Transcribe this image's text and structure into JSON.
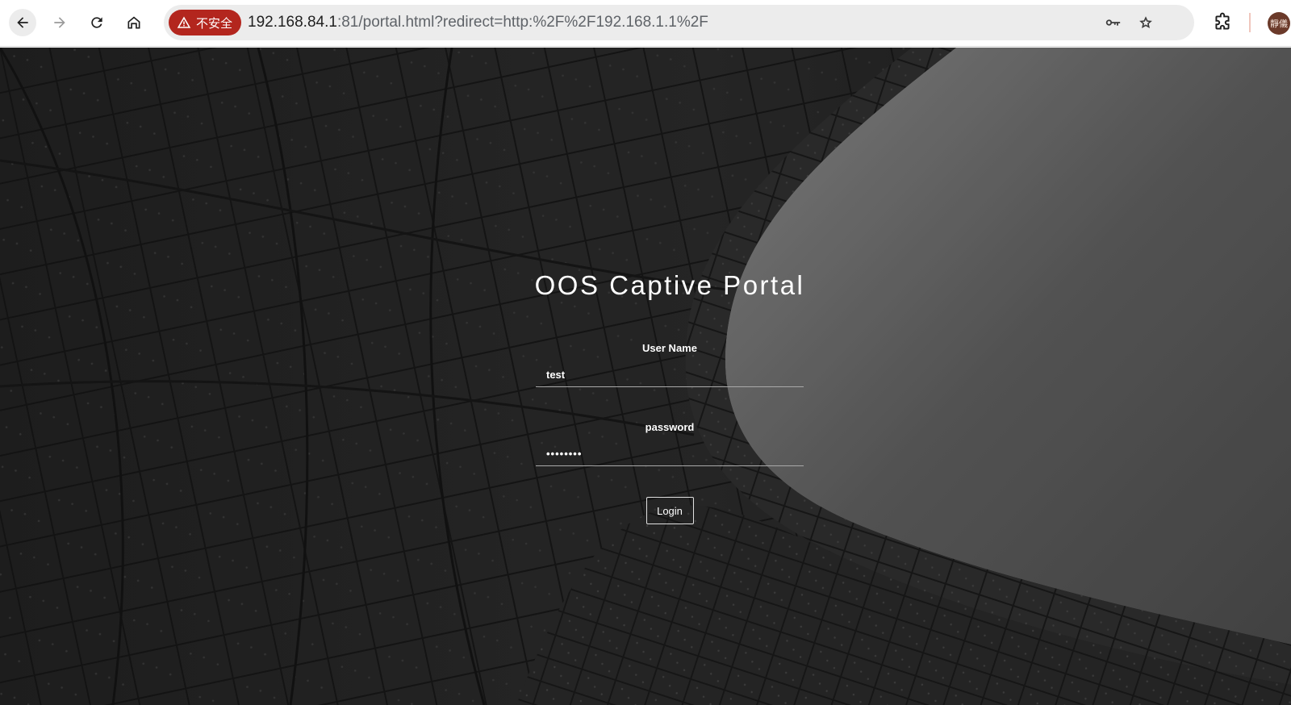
{
  "browser": {
    "security_chip": "不安全",
    "url_host": "192.168.84.1",
    "url_rest": ":81/portal.html?redirect=http:%2F%2F192.168.1.1%2F",
    "profile_avatar": "靜儀",
    "icons": [
      "back-icon",
      "forward-icon",
      "reload-icon",
      "home-icon",
      "warning-icon",
      "key-icon",
      "star-icon",
      "extensions-icon"
    ]
  },
  "portal": {
    "title": "OOS Captive Portal",
    "username_label": "User Name",
    "username_value": "test",
    "password_label": "password",
    "password_value": "••••••••",
    "login_label": "Login"
  },
  "colors": {
    "chip_red": "#b3261e",
    "page_dark": "#262626",
    "page_light": "#6a6a6a",
    "text_white": "#ffffff"
  }
}
